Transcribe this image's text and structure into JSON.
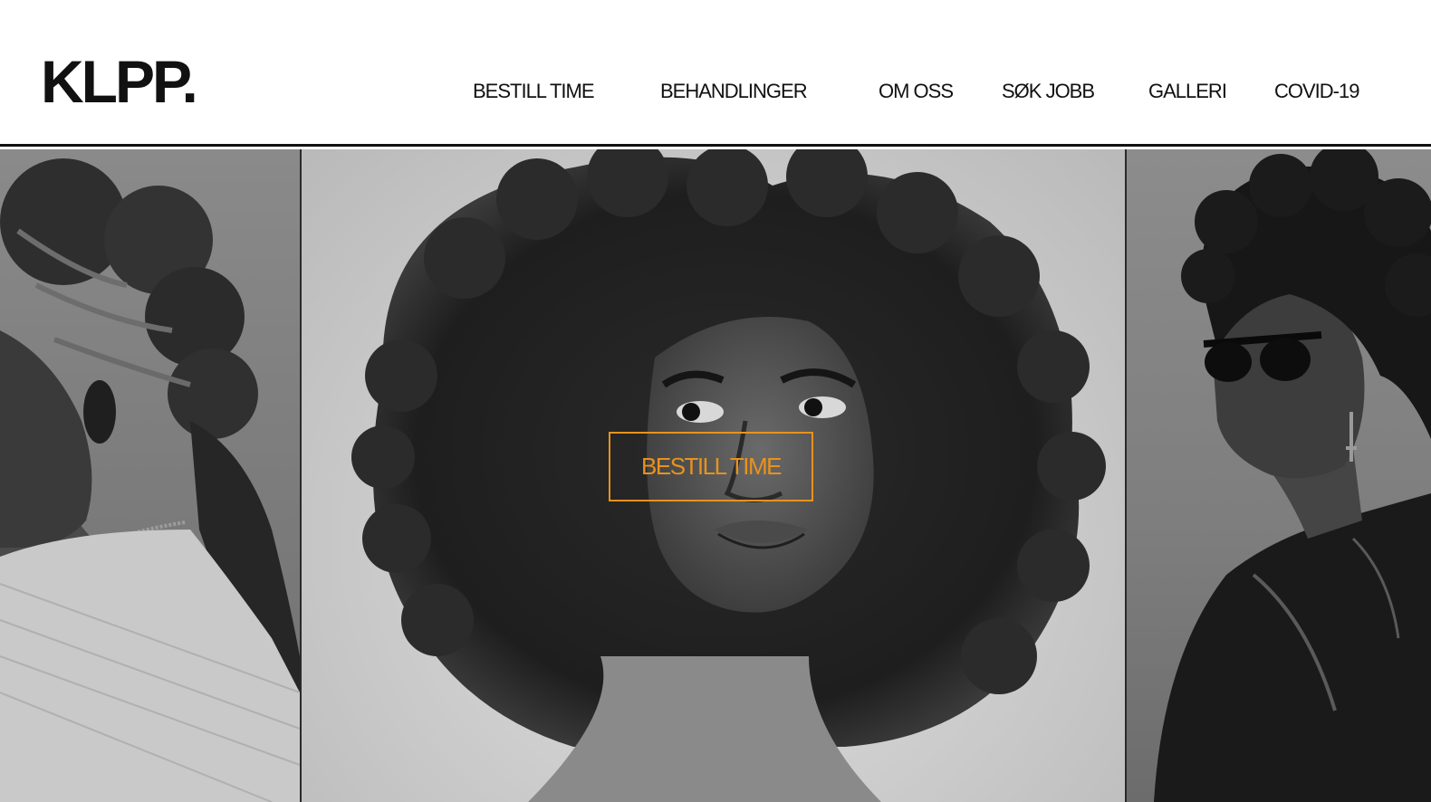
{
  "header": {
    "logo": "KLPP.",
    "nav": [
      {
        "label": "BESTILL TIME"
      },
      {
        "label": "BEHANDLINGER"
      },
      {
        "label": "OM OSS"
      },
      {
        "label": "SØK JOBB"
      },
      {
        "label": "GALLERI"
      },
      {
        "label": "COVID-19"
      }
    ]
  },
  "hero": {
    "cta_label": "BESTILL TIME",
    "accent_color": "#e8921e",
    "images": [
      {
        "name": "portrait-braided-hair",
        "tone": "grayscale"
      },
      {
        "name": "portrait-curly-afro",
        "tone": "grayscale"
      },
      {
        "name": "portrait-sunglasses-leather-jacket",
        "tone": "grayscale"
      }
    ]
  }
}
